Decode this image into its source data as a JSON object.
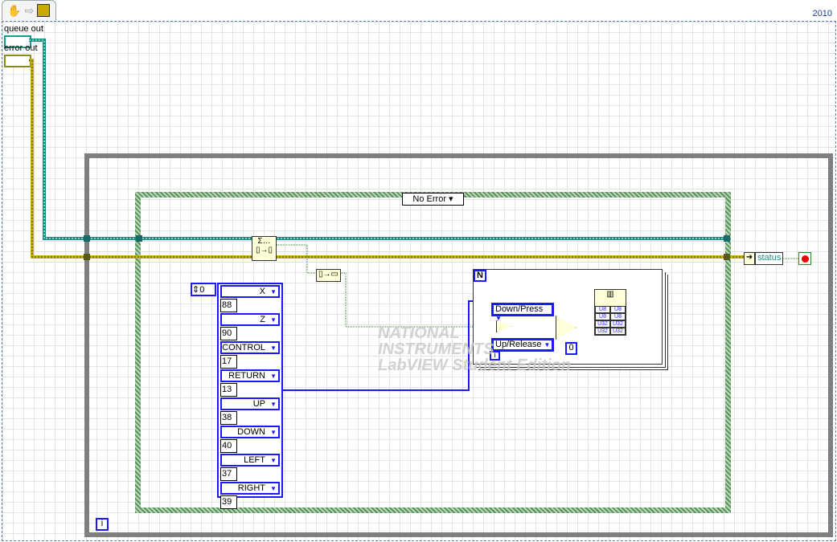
{
  "toolbar": {
    "icons": [
      "hand-icon",
      "arrow-right-icon",
      "vi-icon"
    ]
  },
  "version": "2010",
  "terminals": {
    "queue_out": "queue out",
    "error_out": "error out",
    "status": "status"
  },
  "case_selector": "No Error",
  "array": {
    "index": "0",
    "items": [
      {
        "key": "X",
        "code": "88"
      },
      {
        "key": "Z",
        "code": "90"
      },
      {
        "key": "CONTROL",
        "code": "17"
      },
      {
        "key": "RETURN",
        "code": "13"
      },
      {
        "key": "UP",
        "code": "38"
      },
      {
        "key": "DOWN",
        "code": "40"
      },
      {
        "key": "LEFT",
        "code": "37"
      },
      {
        "key": "RIGHT",
        "code": "39"
      }
    ]
  },
  "for_loop": {
    "count_label": "N",
    "iteration_label": "i",
    "true_const": "Down/Press",
    "false_const": "Up/Release",
    "zero_const": "0",
    "cluster_types": [
      "U8",
      "U8",
      "U8",
      "U8",
      "U32",
      "U32",
      "U32",
      "U32"
    ]
  },
  "while_loop": {
    "iteration_label": "i"
  },
  "watermark": [
    "NATIONAL",
    "INSTRUMENTS",
    "LabVIEW Student Edition"
  ],
  "colors": {
    "queue_wire": "#0f8f7f",
    "error_wire": "#c8b400",
    "numeric_wire": "#1a1aff",
    "bool_wire": "#2a8a2a"
  }
}
